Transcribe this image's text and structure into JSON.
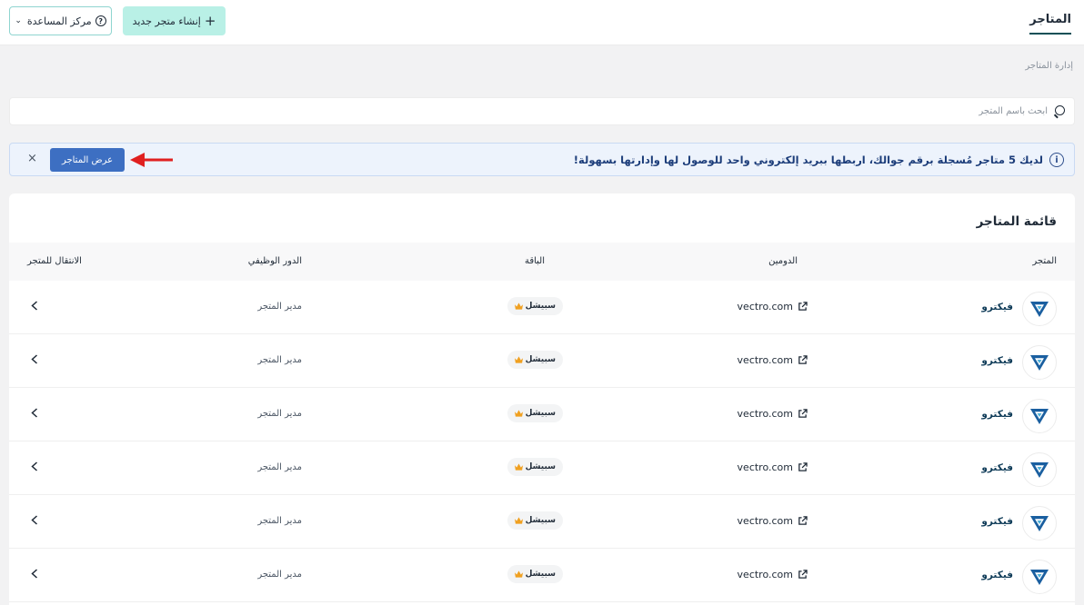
{
  "header": {
    "title": "المتاجر",
    "create_button_label": "إنشاء متجر جديد",
    "help_button_label": "مركز المساعدة"
  },
  "breadcrumb": "إدارة المتاجر",
  "search": {
    "placeholder": "ابحث باسم المتجر"
  },
  "alert": {
    "message": "لديك 5 متاجر مُسجلة برقم جوالك، اربطها ببريد إلكتروني واحد للوصول لها وإدارتها بسهولة!",
    "button_label": "عرض المتاجر",
    "close_symbol": "×"
  },
  "table": {
    "title": "قائمة المتاجر",
    "columns": {
      "store": "المتجر",
      "domain": "الدومين",
      "plan": "الباقة",
      "role": "الدور الوظيفي",
      "goto": "الانتقال للمتجر"
    },
    "rows": [
      {
        "store": "فيكترو",
        "domain": "vectro.com",
        "plan": "سبيشل",
        "role": "مدير المتجر"
      },
      {
        "store": "فيكترو",
        "domain": "vectro.com",
        "plan": "سبيشل",
        "role": "مدير المتجر"
      },
      {
        "store": "فيكترو",
        "domain": "vectro.com",
        "plan": "سبيشل",
        "role": "مدير المتجر"
      },
      {
        "store": "فيكترو",
        "domain": "vectro.com",
        "plan": "سبيشل",
        "role": "مدير المتجر"
      },
      {
        "store": "فيكترو",
        "domain": "vectro.com",
        "plan": "سبيشل",
        "role": "مدير المتجر"
      },
      {
        "store": "فيكترو",
        "domain": "vectro.com",
        "plan": "سبيشل",
        "role": "مدير المتجر"
      }
    ]
  },
  "icons": {
    "help": "question-circle-icon",
    "create": "plus-icon",
    "search": "search-icon",
    "info": "info-icon",
    "close": "close-icon",
    "domain": "external-link-icon",
    "plan": "crown-icon",
    "goto": "chevron-left-icon",
    "annotation": "red-arrow-icon"
  },
  "colors": {
    "accent": "#0f5057",
    "primary_button": "#3d6fc2",
    "create_button_bg": "#b9f0e6",
    "alert_bg": "#edf3fc",
    "alert_text": "#1c3d7a",
    "annotation_arrow": "#e02020",
    "crown": "#f0a020",
    "logo": "#1a5fa0"
  }
}
